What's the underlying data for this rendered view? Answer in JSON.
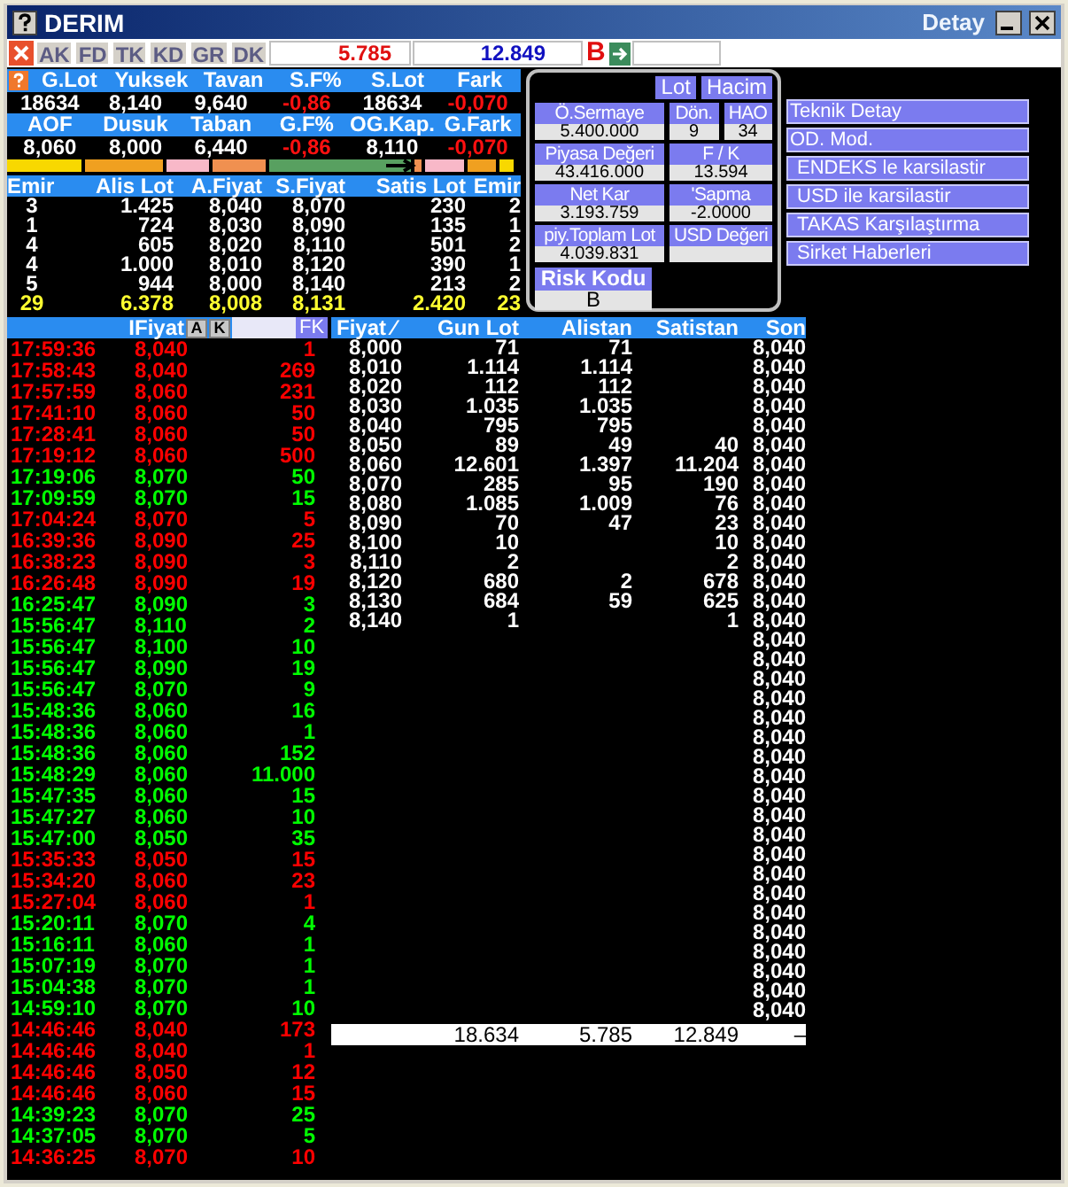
{
  "window": {
    "title": "DERIM",
    "detail_title": "Detay"
  },
  "toolbar": {
    "tabs": [
      {
        "label": "AK",
        "disabled": true
      },
      {
        "label": "FD",
        "disabled": true
      },
      {
        "label": "TK",
        "disabled": true
      },
      {
        "label": "KD",
        "disabled": true
      },
      {
        "label": "GR",
        "disabled": true
      },
      {
        "label": "DK",
        "disabled": true
      }
    ],
    "sell_total": "5.785",
    "buy_total": "12.849",
    "flag": "B"
  },
  "stats": [
    {
      "headers": [
        "G.Lot",
        "Yuksek",
        "Tavan",
        "S.F%",
        "S.Lot",
        "Fark"
      ],
      "values": [
        {
          "text": "18634",
          "negative": false
        },
        {
          "text": "8,140",
          "negative": false
        },
        {
          "text": "9,640",
          "negative": false
        },
        {
          "text": "-0,86",
          "negative": true
        },
        {
          "text": "18634",
          "negative": false
        },
        {
          "text": "-0,070",
          "negative": true
        }
      ]
    },
    {
      "headers": [
        "AOF",
        "Dusuk",
        "Taban",
        "G.F%",
        "OG.Kap.",
        "G.Fark"
      ],
      "values": [
        {
          "text": "8,060",
          "negative": false
        },
        {
          "text": "8,000",
          "negative": false
        },
        {
          "text": "6,440",
          "negative": false
        },
        {
          "text": "-0,86",
          "negative": true
        },
        {
          "text": "8,110",
          "negative": false
        },
        {
          "text": "-0,070",
          "negative": true
        }
      ]
    }
  ],
  "order_book": {
    "columns": [
      "Emir",
      "Alis Lot",
      "A.Fiyat",
      "S.Fiyat",
      "Satis Lot",
      "Emir"
    ],
    "rows": [
      [
        "3",
        "1.425",
        "8,040",
        "8,070",
        "230",
        "2"
      ],
      [
        "1",
        "724",
        "8,030",
        "8,090",
        "135",
        "1"
      ],
      [
        "4",
        "605",
        "8,020",
        "8,110",
        "501",
        "2"
      ],
      [
        "4",
        "1.000",
        "8,010",
        "8,120",
        "390",
        "1"
      ],
      [
        "5",
        "944",
        "8,000",
        "8,140",
        "213",
        "2"
      ]
    ],
    "totals": [
      "29",
      "6.378",
      "8,008",
      "8,131",
      "2.420",
      "23"
    ]
  },
  "detail": {
    "units": [
      "Lot",
      "Hacim"
    ],
    "rows": [
      [
        {
          "label": "Ö.Sermaye",
          "value": "5.400.000"
        },
        {
          "label": "Dön.",
          "value": "9"
        },
        {
          "label": "HAO",
          "value": "34"
        }
      ],
      [
        {
          "label": "Piyasa Değeri",
          "value": "43.416.000"
        },
        {
          "label": "F / K",
          "value": "13.594"
        }
      ],
      [
        {
          "label": "Net Kar",
          "value": "3.193.759"
        },
        {
          "label": "'Sapma",
          "value": "-2.0000"
        }
      ],
      [
        {
          "label": "piy.Toplam Lot",
          "value": "4.039.831"
        },
        {
          "label": "USD Değeri"
        }
      ]
    ],
    "risk": {
      "label": "Risk Kodu",
      "value": "B"
    }
  },
  "menu": [
    "Teknik Detay",
    "OD. Mod.",
    "ENDEKS le karsilastir",
    "USD ile karsilastir",
    "TAKAS Karşılaştırma",
    "Sirket Haberleri"
  ],
  "trades": {
    "column": "IFiyat",
    "buttons": [
      "A",
      "K"
    ],
    "filter_button": "FK",
    "rows": [
      {
        "time": "17:59:36",
        "price": "8,040",
        "lot": "1",
        "down": true
      },
      {
        "time": "17:58:43",
        "price": "8,040",
        "lot": "269",
        "down": true
      },
      {
        "time": "17:57:59",
        "price": "8,060",
        "lot": "231",
        "down": true
      },
      {
        "time": "17:41:10",
        "price": "8,060",
        "lot": "50",
        "down": true
      },
      {
        "time": "17:28:41",
        "price": "8,060",
        "lot": "50",
        "down": true
      },
      {
        "time": "17:19:12",
        "price": "8,060",
        "lot": "500",
        "down": true
      },
      {
        "time": "17:19:06",
        "price": "8,070",
        "lot": "50",
        "down": false
      },
      {
        "time": "17:09:59",
        "price": "8,070",
        "lot": "15",
        "down": false
      },
      {
        "time": "17:04:24",
        "price": "8,070",
        "lot": "5",
        "down": true
      },
      {
        "time": "16:39:36",
        "price": "8,090",
        "lot": "25",
        "down": true
      },
      {
        "time": "16:38:23",
        "price": "8,090",
        "lot": "3",
        "down": true
      },
      {
        "time": "16:26:48",
        "price": "8,090",
        "lot": "19",
        "down": true
      },
      {
        "time": "16:25:47",
        "price": "8,090",
        "lot": "3",
        "down": false
      },
      {
        "time": "15:56:47",
        "price": "8,110",
        "lot": "2",
        "down": false
      },
      {
        "time": "15:56:47",
        "price": "8,100",
        "lot": "10",
        "down": false
      },
      {
        "time": "15:56:47",
        "price": "8,090",
        "lot": "19",
        "down": false
      },
      {
        "time": "15:56:47",
        "price": "8,070",
        "lot": "9",
        "down": false
      },
      {
        "time": "15:48:36",
        "price": "8,060",
        "lot": "16",
        "down": false
      },
      {
        "time": "15:48:36",
        "price": "8,060",
        "lot": "1",
        "down": false
      },
      {
        "time": "15:48:36",
        "price": "8,060",
        "lot": "152",
        "down": false
      },
      {
        "time": "15:48:29",
        "price": "8,060",
        "lot": "11.000",
        "down": false
      },
      {
        "time": "15:47:35",
        "price": "8,060",
        "lot": "15",
        "down": false
      },
      {
        "time": "15:47:27",
        "price": "8,060",
        "lot": "10",
        "down": false
      },
      {
        "time": "15:47:00",
        "price": "8,050",
        "lot": "35",
        "down": false
      },
      {
        "time": "15:35:33",
        "price": "8,050",
        "lot": "15",
        "down": true
      },
      {
        "time": "15:34:20",
        "price": "8,060",
        "lot": "23",
        "down": true
      },
      {
        "time": "15:27:04",
        "price": "8,060",
        "lot": "1",
        "down": true
      },
      {
        "time": "15:20:11",
        "price": "8,070",
        "lot": "4",
        "down": false
      },
      {
        "time": "15:16:11",
        "price": "8,060",
        "lot": "1",
        "down": false
      },
      {
        "time": "15:07:19",
        "price": "8,070",
        "lot": "1",
        "down": false
      },
      {
        "time": "15:04:38",
        "price": "8,070",
        "lot": "1",
        "down": false
      },
      {
        "time": "14:59:10",
        "price": "8,070",
        "lot": "10",
        "down": false
      },
      {
        "time": "14:46:46",
        "price": "8,040",
        "lot": "173",
        "down": true
      },
      {
        "time": "14:46:46",
        "price": "8,040",
        "lot": "1",
        "down": true
      },
      {
        "time": "14:46:46",
        "price": "8,050",
        "lot": "12",
        "down": true
      },
      {
        "time": "14:46:46",
        "price": "8,060",
        "lot": "15",
        "down": true
      },
      {
        "time": "14:39:23",
        "price": "8,070",
        "lot": "25",
        "down": false
      },
      {
        "time": "14:37:05",
        "price": "8,070",
        "lot": "5",
        "down": false
      },
      {
        "time": "14:36:25",
        "price": "8,070",
        "lot": "10",
        "down": true
      }
    ]
  },
  "distribution": {
    "columns": [
      "Fiyat ∕",
      "Gun Lot",
      "Alistan",
      "Satistan",
      "Son"
    ],
    "rows": [
      {
        "price": "8,000",
        "gun_lot": "71",
        "alistan": "71",
        "son": "8,040"
      },
      {
        "price": "8,010",
        "gun_lot": "1.114",
        "alistan": "1.114",
        "son": "8,040"
      },
      {
        "price": "8,020",
        "gun_lot": "112",
        "alistan": "112",
        "son": "8,040"
      },
      {
        "price": "8,030",
        "gun_lot": "1.035",
        "alistan": "1.035",
        "son": "8,040"
      },
      {
        "price": "8,040",
        "gun_lot": "795",
        "alistan": "795",
        "son": "8,040"
      },
      {
        "price": "8,050",
        "gun_lot": "89",
        "alistan": "49",
        "satistan": "40",
        "son": "8,040"
      },
      {
        "price": "8,060",
        "gun_lot": "12.601",
        "alistan": "1.397",
        "satistan": "11.204",
        "son": "8,040"
      },
      {
        "price": "8,070",
        "gun_lot": "285",
        "alistan": "95",
        "satistan": "190",
        "son": "8,040"
      },
      {
        "price": "8,080",
        "gun_lot": "1.085",
        "alistan": "1.009",
        "satistan": "76",
        "son": "8,040"
      },
      {
        "price": "8,090",
        "gun_lot": "70",
        "alistan": "47",
        "satistan": "23",
        "son": "8,040"
      },
      {
        "price": "8,100",
        "gun_lot": "10",
        "satistan": "10",
        "son": "8,040"
      },
      {
        "price": "8,110",
        "gun_lot": "2",
        "satistan": "2",
        "son": "8,040"
      },
      {
        "price": "8,120",
        "gun_lot": "680",
        "alistan": "2",
        "satistan": "678",
        "son": "8,040"
      },
      {
        "price": "8,130",
        "gun_lot": "684",
        "alistan": "59",
        "satistan": "625",
        "son": "8,040"
      },
      {
        "price": "8,140",
        "gun_lot": "1",
        "satistan": "1",
        "son": "8,040"
      },
      {
        "son": "8,040"
      },
      {
        "son": "8,040"
      },
      {
        "son": "8,040"
      },
      {
        "son": "8,040"
      },
      {
        "son": "8,040"
      },
      {
        "son": "8,040"
      },
      {
        "son": "8,040"
      },
      {
        "son": "8,040"
      },
      {
        "son": "8,040"
      },
      {
        "son": "8,040"
      },
      {
        "son": "8,040"
      },
      {
        "son": "8,040"
      },
      {
        "son": "8,040"
      },
      {
        "son": "8,040"
      },
      {
        "son": "8,040"
      },
      {
        "son": "8,040"
      },
      {
        "son": "8,040"
      },
      {
        "son": "8,040"
      },
      {
        "son": "8,040"
      },
      {
        "son": "8,040"
      }
    ],
    "totals": [
      "18.634",
      "5.785",
      "12.849",
      "–"
    ]
  }
}
